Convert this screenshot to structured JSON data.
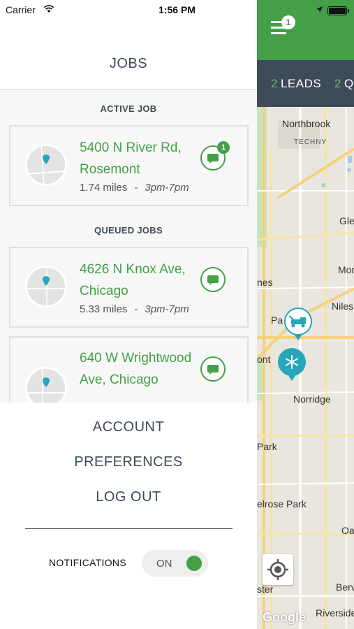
{
  "status_bar": {
    "carrier": "Carrier",
    "time": "1:56 PM"
  },
  "map": {
    "header_badge": "1",
    "leads_bar": [
      {
        "count": "2",
        "label": "LEADS"
      },
      {
        "count": "2",
        "label": "Q"
      }
    ],
    "place_labels": [
      "Northbrook",
      "TECHNY",
      "Gle",
      "Mor",
      "nes",
      "Niles",
      "Pa",
      "ont",
      "Norridge",
      "Park",
      "elrose Park",
      "Oa",
      "Berv",
      "ster",
      "Riverside"
    ],
    "google": "Google",
    "accent_green": "#43a047"
  },
  "drawer": {
    "title": "JOBS",
    "active_label": "ACTIVE JOB",
    "queued_label": "QUEUED JOBS",
    "jobs": [
      {
        "address": "5400 N River Rd, Rosemont",
        "distance": "1.74 miles",
        "separator": "-",
        "window": "3pm-7pm",
        "badge": "1"
      },
      {
        "address": "4626 N Knox Ave, Chicago",
        "distance": "5.33 miles",
        "separator": "-",
        "window": "3pm-7pm",
        "badge": ""
      },
      {
        "address": "640 W Wrightwood Ave, Chicago",
        "distance": "",
        "separator": "",
        "window": "",
        "badge": ""
      }
    ],
    "menu": {
      "account": "ACCOUNT",
      "preferences": "PREFERENCES",
      "logout": "LOG OUT"
    },
    "notifications": {
      "label": "NOTIFICATIONS",
      "toggle": "ON"
    }
  }
}
